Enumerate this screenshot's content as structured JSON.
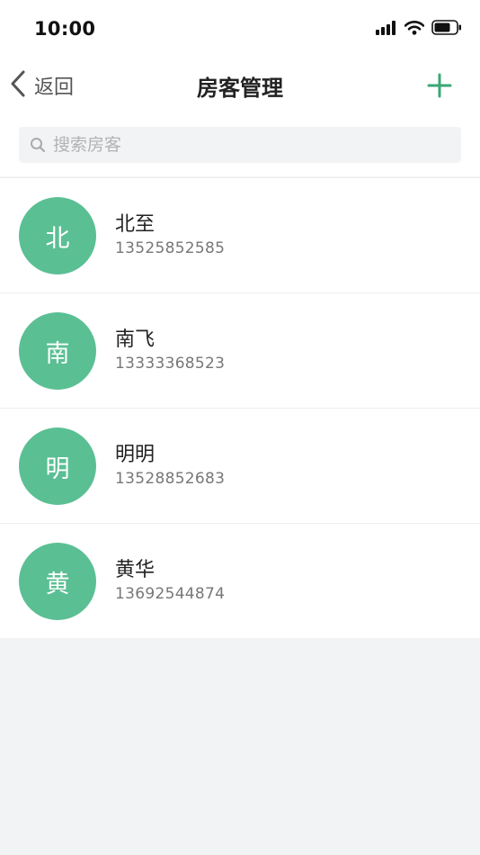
{
  "status_bar": {
    "time": "10:00",
    "icons": [
      "signal-icon",
      "wifi-icon",
      "battery-icon"
    ]
  },
  "nav": {
    "back_label": "返回",
    "title": "房客管理",
    "add_icon": "plus-icon"
  },
  "search": {
    "placeholder": "搜索房客",
    "value": ""
  },
  "contacts": [
    {
      "avatar": "北",
      "name": "北至",
      "phone": "13525852585"
    },
    {
      "avatar": "南",
      "name": "南飞",
      "phone": "13333368523"
    },
    {
      "avatar": "明",
      "name": "明明",
      "phone": "13528852683"
    },
    {
      "avatar": "黄",
      "name": "黄华",
      "phone": "13692544874"
    }
  ],
  "colors": {
    "accent": "#5bbf94",
    "page_background": "#f2f3f5",
    "surface": "#ffffff"
  }
}
